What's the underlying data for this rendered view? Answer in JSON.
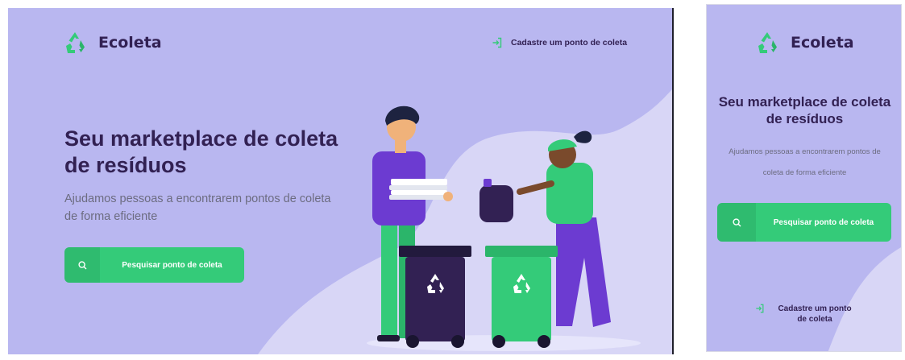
{
  "brand": {
    "name": "Ecoleta",
    "logo_icon": "recycle-icon",
    "colors": {
      "primary": "#34cb79",
      "title": "#322153",
      "text": "#6c6c80",
      "background": "#b9b7f0"
    }
  },
  "desktop": {
    "header": {
      "cadastre_label": "Cadastre um ponto de coleta",
      "cadastre_icon": "log-in-icon"
    },
    "hero": {
      "title": "Seu marketplace de coleta de resíduos",
      "description": "Ajudamos pessoas a encontrarem pontos de coleta de forma eficiente",
      "search_button": {
        "label": "Pesquisar ponto de coleta",
        "icon": "search-icon"
      }
    },
    "illustration": "people-recycling-illustration"
  },
  "mobile": {
    "hero": {
      "title": "Seu marketplace de coleta de resíduos",
      "description": "Ajudamos pessoas a encontrarem pontos de coleta de forma eficiente",
      "search_button": {
        "label": "Pesquisar ponto de coleta",
        "icon": "search-icon"
      }
    },
    "footer": {
      "cadastre_label": "Cadastre um ponto de coleta",
      "cadastre_icon": "log-in-icon"
    }
  }
}
